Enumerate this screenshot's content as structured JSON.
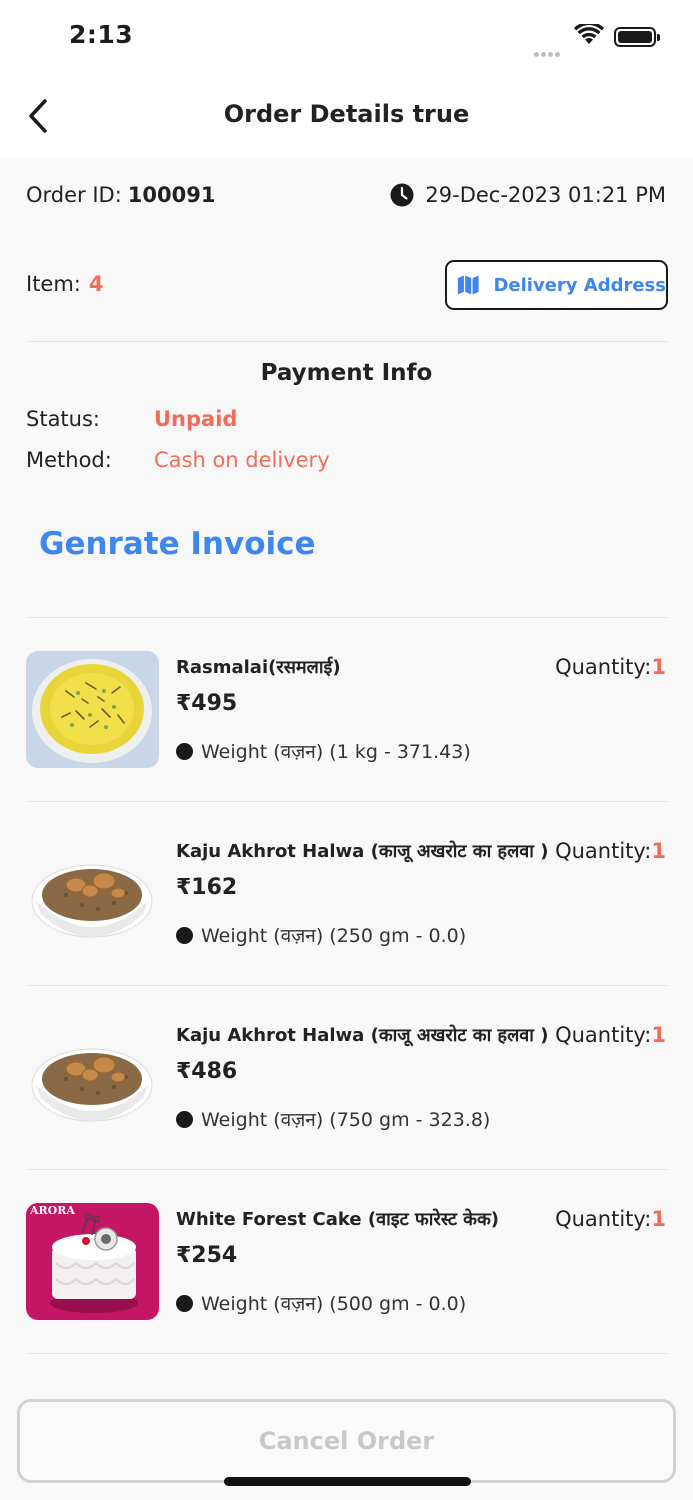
{
  "status_bar": {
    "time": "2:13"
  },
  "header": {
    "title": "Order Details true"
  },
  "order": {
    "id_label": "Order ID:",
    "id_value": "100091",
    "datetime": "29-Dec-2023 01:21 PM",
    "item_label": "Item:",
    "item_count": "4",
    "delivery_button_label": "Delivery Address"
  },
  "payment": {
    "title": "Payment Info",
    "status_label": "Status:",
    "status_value": "Unpaid",
    "method_label": "Method:",
    "method_value": "Cash on delivery"
  },
  "invoice_label": "Genrate Invoice",
  "products": [
    {
      "name": "Rasmalai(रसमलाई)",
      "price": "₹495",
      "quantity_label": "Quantity:",
      "quantity": "1",
      "weight": "Weight (वज़न) (1 kg - 371.43)",
      "image": "rasmalai-image"
    },
    {
      "name": "Kaju Akhrot Halwa (काजू अखरोट का हलवा )",
      "price": "₹162",
      "quantity_label": "Quantity:",
      "quantity": "1",
      "weight": "Weight (वज़न) (250 gm - 0.0)",
      "image": "halwa-image"
    },
    {
      "name": "Kaju Akhrot Halwa (काजू अखरोट का हलवा )",
      "price": "₹486",
      "quantity_label": "Quantity:",
      "quantity": "1",
      "weight": "Weight (वज़न) (750 gm - 323.8)",
      "image": "halwa-image"
    },
    {
      "name": "White Forest Cake (वाइट फारेस्ट केक)",
      "price": "₹254",
      "quantity_label": "Quantity:",
      "quantity": "1",
      "weight": "Weight (वज़न) (500 gm - 0.0)",
      "image": "cake-image",
      "image_text": "ARORA"
    }
  ],
  "cancel_button_label": "Cancel Order",
  "colors": {
    "accent_red": "#f26c5a",
    "accent_blue": "#3e86f0",
    "disabled_gray": "#c9c9c9"
  }
}
